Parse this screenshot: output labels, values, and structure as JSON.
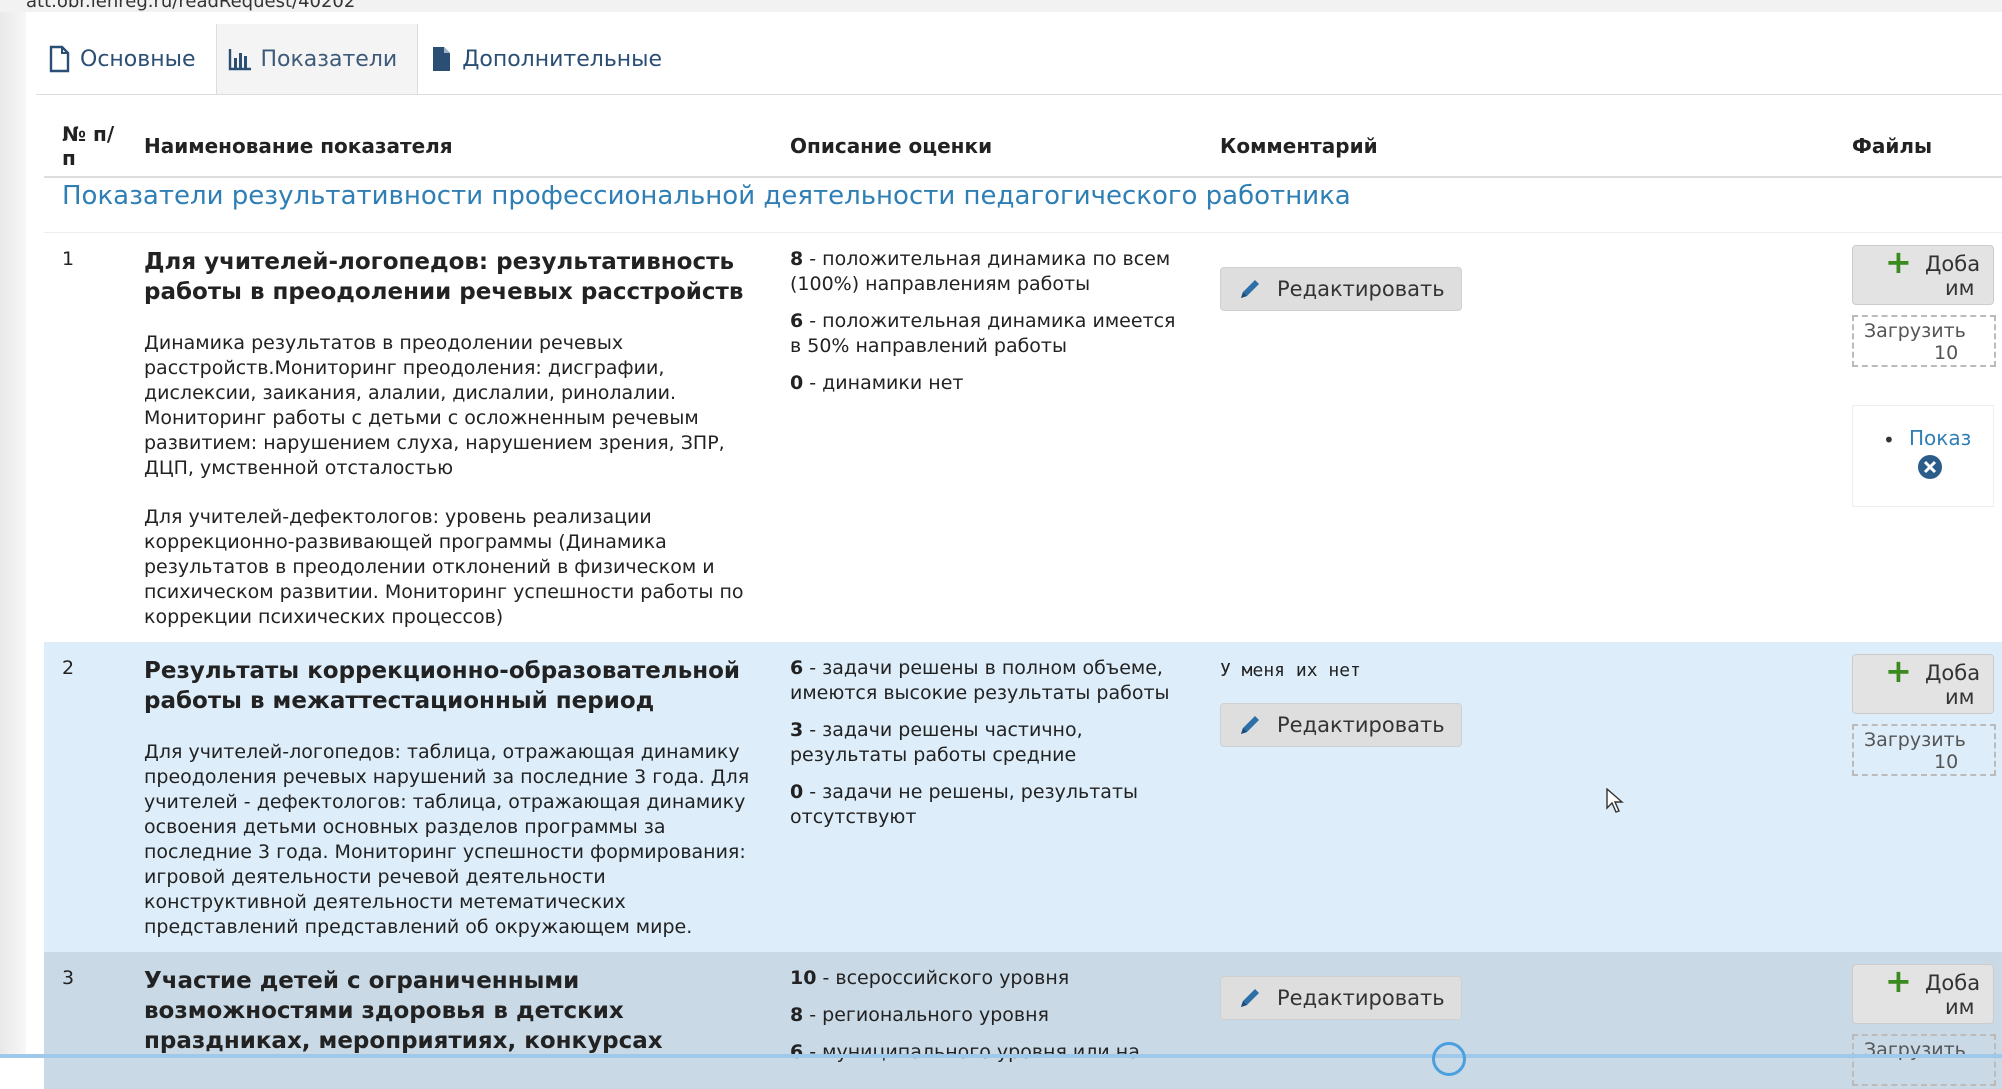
{
  "url_partial": "att.obr.lenreg.ru/readRequest/40202",
  "tabs": [
    {
      "label": "Основные",
      "icon": "file-icon"
    },
    {
      "label": "Показатели",
      "icon": "bar-chart-icon"
    },
    {
      "label": "Дополнительные",
      "icon": "document-icon"
    }
  ],
  "active_tab": "Показатели",
  "columns": {
    "num": "№ п/п",
    "name": "Наименование показателя",
    "description": "Описание оценки",
    "comment": "Комментарий",
    "files": "Файлы"
  },
  "section_title": "Показатели результативности профессиональной деятельности педагогического работника",
  "rows": [
    {
      "num": "1",
      "title": "Для учителей-логопедов: результативность работы в преодолении речевых расстройств",
      "desc1": "Динамика результатов в преодолении речевых расстройств.Мониторинг преодоления: дисграфии, дислексии, заикания, алалии, дислалии, ринолалии. Мониторинг работы с детьми с осложненным речевым развитием: нарушением слуха, нарушением зрения, ЗПР, ДЦП, умственной отсталостью",
      "desc2": "Для учителей-дефектологов: уровень реализации коррекционно-развивающей программы (Динамика результатов в преодолении отклонений в физическом и психическом развитии. Мониторинг успешности работы по коррекции психических процессов)",
      "criteria": [
        {
          "score": "8",
          "text": " - положительная динамика по всем (100%) направлениям работы"
        },
        {
          "score": "6",
          "text": " - положительная динамика имеется в 50% направлений работы"
        },
        {
          "score": "0",
          "text": " - динамики нет"
        }
      ],
      "comment": "",
      "edit_label": "Редактировать",
      "add_label_1": "Доба",
      "add_label_2": "им",
      "upload_1": "Загрузить",
      "upload_2": "10",
      "file_link": "Показ"
    },
    {
      "num": "2",
      "title": "Результаты коррекционно-образовательной работы в межаттестационный период",
      "desc1": "Для учителей-логопедов: таблица, отражающая динамику преодоления речевых нарушений за последние 3 года. Для учителей - дефектологов: таблица, отражающая динамику освоения детьми основных разделов программы за последние 3 года. Мониторинг успешности формирования: игровой деятельности речевой деятельности конструктивной деятельности метематических представлений представлений об окружающем мире.",
      "criteria": [
        {
          "score": "6",
          "text": " - задачи решены в полном объеме, имеются высокие результаты работы"
        },
        {
          "score": "3",
          "text": " - задачи решены частично, результаты работы средние"
        },
        {
          "score": "0",
          "text": " - задачи не решены, результаты отсутствуют"
        }
      ],
      "comment": "У меня их нет",
      "edit_label": "Редактировать",
      "add_label_1": "Доба",
      "add_label_2": "им",
      "upload_1": "Загрузить",
      "upload_2": "10"
    },
    {
      "num": "3",
      "title": "Участие детей с ограниченными возможностями здоровья в детских праздниках, мероприятиях, конкурсах",
      "criteria": [
        {
          "score": "10",
          "text": " - всероссийского уровня"
        },
        {
          "score": "8",
          "text": " - регионального уровня"
        },
        {
          "score": "6",
          "text": " - муниципального уровня или на"
        }
      ],
      "edit_label": "Редактировать",
      "add_label_1": "Доба",
      "add_label_2": "им",
      "upload_1": "Загрузить"
    }
  ],
  "colors": {
    "link_blue": "#2f7fb5",
    "row_highlight": "#ddeefa",
    "plus_green": "#3a8a1f"
  }
}
